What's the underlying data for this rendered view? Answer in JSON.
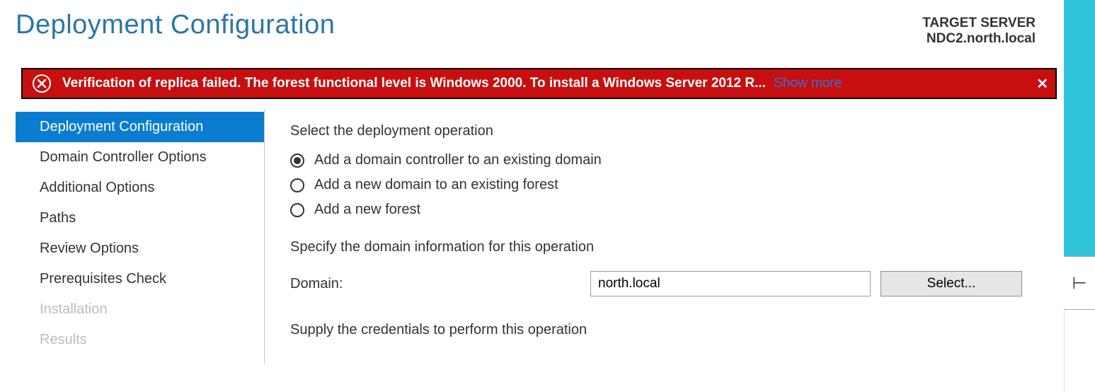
{
  "header": {
    "title": "Deployment Configuration",
    "target_label": "TARGET SERVER",
    "target_name": "NDC2.north.local"
  },
  "error": {
    "message": "Verification of replica failed. The forest functional level is Windows 2000. To install a Windows Server 2012 R...",
    "show_more": "Show more"
  },
  "sidebar": {
    "items": [
      {
        "label": "Deployment Configuration",
        "state": "selected"
      },
      {
        "label": "Domain Controller Options",
        "state": "normal"
      },
      {
        "label": "Additional Options",
        "state": "normal"
      },
      {
        "label": "Paths",
        "state": "normal"
      },
      {
        "label": "Review Options",
        "state": "normal"
      },
      {
        "label": "Prerequisites Check",
        "state": "normal"
      },
      {
        "label": "Installation",
        "state": "disabled"
      },
      {
        "label": "Results",
        "state": "disabled"
      }
    ]
  },
  "content": {
    "select_op_label": "Select the deployment operation",
    "radios": [
      {
        "label": "Add a domain controller to an existing domain",
        "checked": true
      },
      {
        "label": "Add a new domain to an existing forest",
        "checked": false
      },
      {
        "label": "Add a new forest",
        "checked": false
      }
    ],
    "specify_label": "Specify the domain information for this operation",
    "domain_field_label": "Domain:",
    "domain_value": "north.local",
    "select_button": "Select...",
    "credentials_label": "Supply the credentials to perform this operation"
  }
}
